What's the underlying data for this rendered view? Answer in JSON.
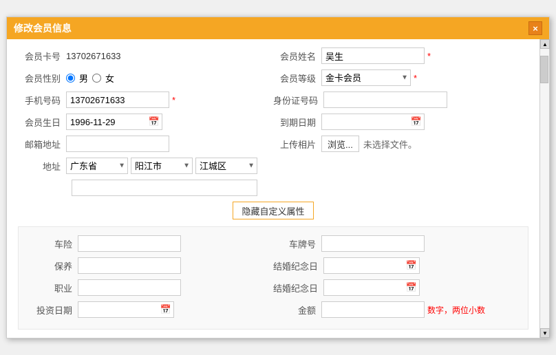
{
  "dialog": {
    "title": "修改会员信息",
    "close_label": "×"
  },
  "form": {
    "member_card_label": "会员卡号",
    "member_card_value": "13702671633",
    "member_name_label": "会员姓名",
    "member_name_value": "吴生",
    "member_gender_label": "会员性别",
    "gender_male": "男",
    "gender_female": "女",
    "member_level_label": "会员等级",
    "member_level_value": "金卡会员",
    "phone_label": "手机号码",
    "phone_value": "13702671633",
    "id_card_label": "身份证号码",
    "birthday_label": "会员生日",
    "birthday_value": "1996-11-29",
    "expire_label": "到期日期",
    "email_label": "邮箱地址",
    "upload_label": "上传相片",
    "browse_btn": "浏览...",
    "no_file": "未选择文件。",
    "address_label": "地址",
    "province_value": "广东省",
    "city_value": "阳江市",
    "district_value": "江城区",
    "hide_custom_btn": "隐藏自定义属性",
    "custom": {
      "car_insurance_label": "车险",
      "license_plate_label": "车牌号",
      "maintenance_label": "保养",
      "wedding_anniversary_label": "结婚纪念日",
      "career_label": "职业",
      "wedding_anniversary2_label": "结婚纪念日",
      "invest_date_label": "投资日期",
      "amount_label": "金额",
      "amount_hint": "数字，两位小数"
    }
  }
}
